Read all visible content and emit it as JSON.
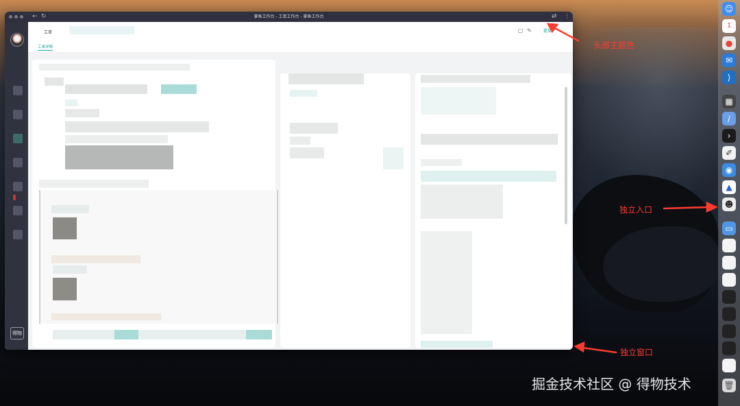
{
  "window": {
    "title": "掌鱼工作台 - 工单工作台 - 掌鱼工作台"
  },
  "sidebar": {
    "bottom_label": "得物"
  },
  "header": {
    "tab_label": "工单",
    "action_label": "提单",
    "sub_tab": "工单详情"
  },
  "annotations": {
    "header_theme": "头部主题色",
    "standalone_entry": "独立入口",
    "standalone_window": "独立窗口"
  },
  "watermark": "掘金技术社区 @ 得物技术",
  "colors": {
    "accent": "#19a7a0",
    "annotation": "#ff3b30",
    "titlebar": "#2f2f3f",
    "sidebar": "#30323f"
  },
  "icons": {
    "header_left_icon": "briefcase-icon",
    "header_right_icon": "edit-icon"
  }
}
